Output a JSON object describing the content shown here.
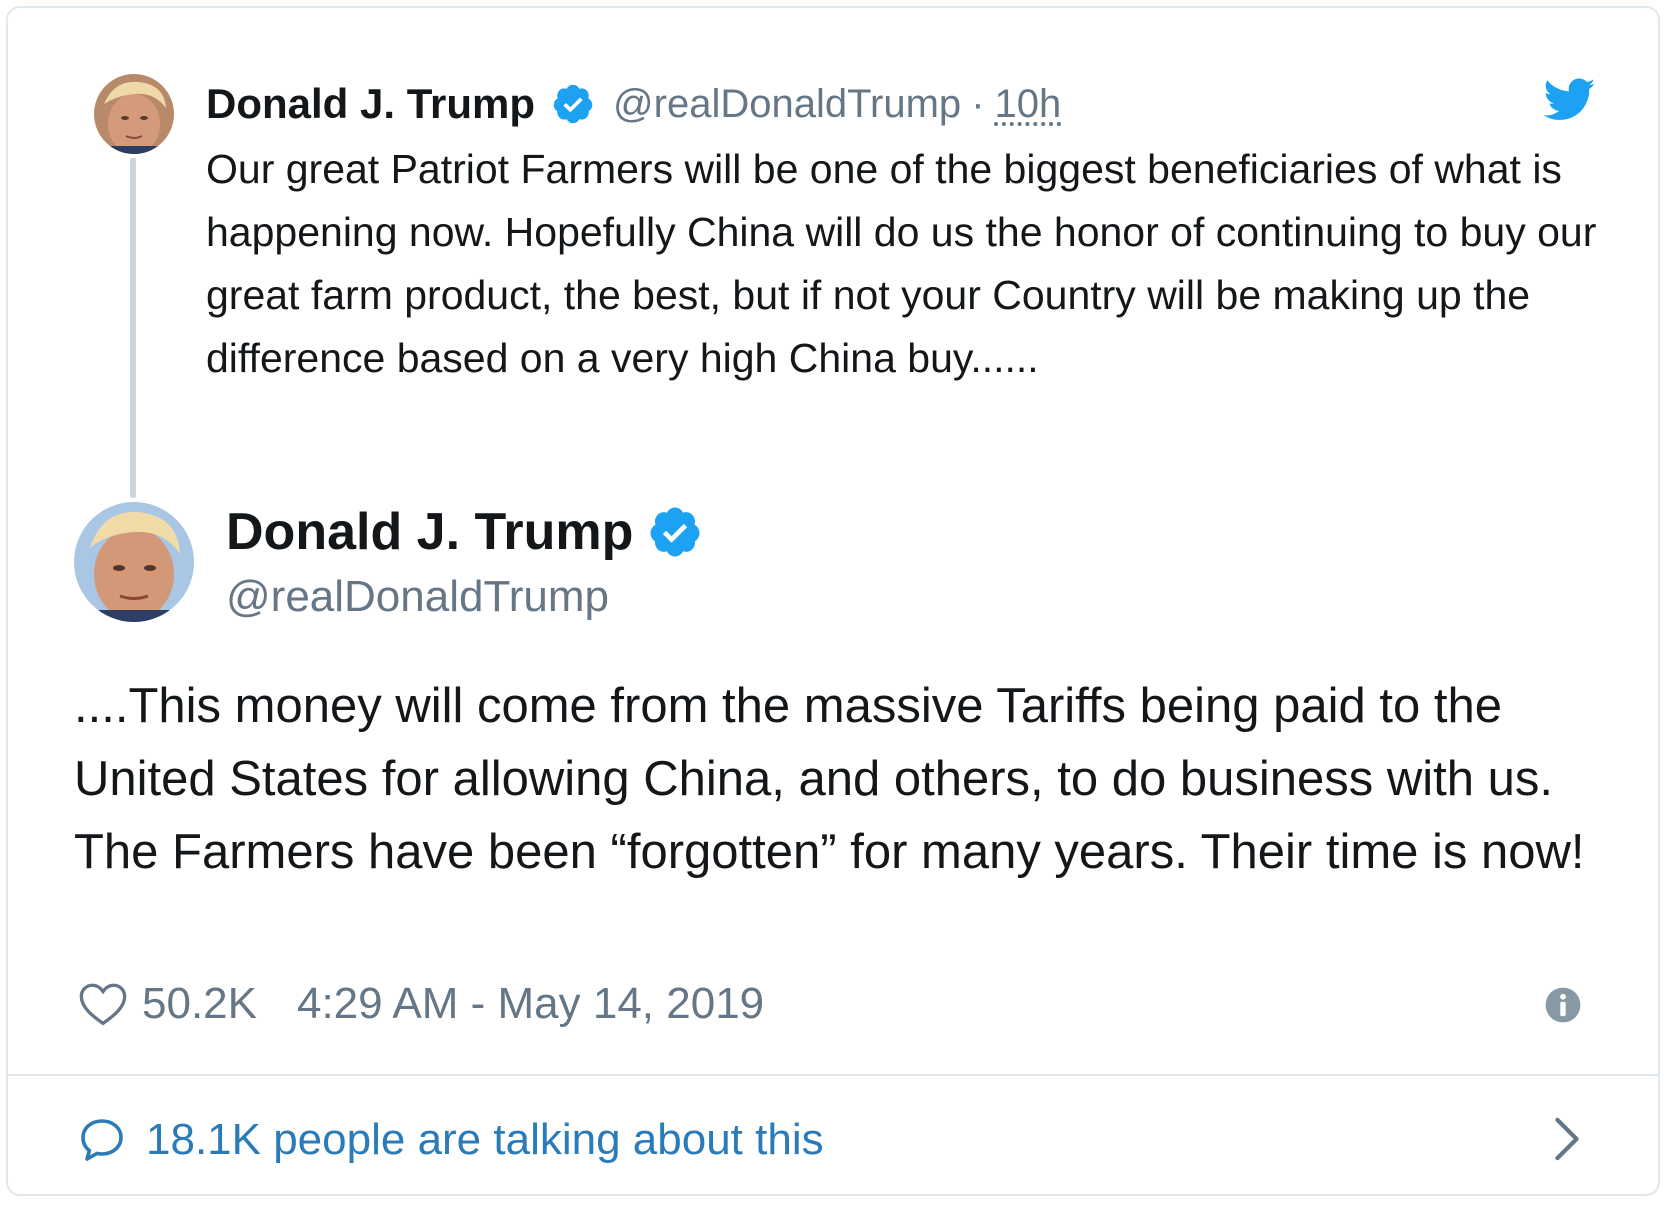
{
  "colors": {
    "name": "#14171a",
    "secondary": "#657786",
    "verified": "#1da1f2",
    "link": "#2b7bb9",
    "border": "#e1e8ed",
    "thread_line": "#ccd6dd"
  },
  "parent_tweet": {
    "author_name": "Donald J. Trump",
    "handle": "@realDonaldTrump",
    "separator": "·",
    "time": "10h",
    "text": "Our great Patriot Farmers will be one of the biggest beneficiaries of what is happening now. Hopefully China will do us the honor of continuing to buy our great farm product, the best, but if not your Country will be making up the difference based on a very high China buy......",
    "icons": [
      "avatar",
      "verified-badge-icon",
      "twitter-bird-icon"
    ]
  },
  "main_tweet": {
    "author_name": "Donald J. Trump",
    "handle": "@realDonaldTrump",
    "text": "....This money will come from the massive Tariffs being paid to the United States for allowing China, and others, to do business with us. The Farmers have been “forgotten” for many years. Their time is now!",
    "likes": "50.2K",
    "timestamp": "4:29 AM - May 14, 2019",
    "icons": [
      "avatar",
      "verified-badge-icon",
      "heart-icon",
      "info-icon"
    ]
  },
  "footer": {
    "text": "18.1K people are talking about this",
    "icons": [
      "speech-bubble-icon",
      "chevron-right-icon"
    ]
  }
}
